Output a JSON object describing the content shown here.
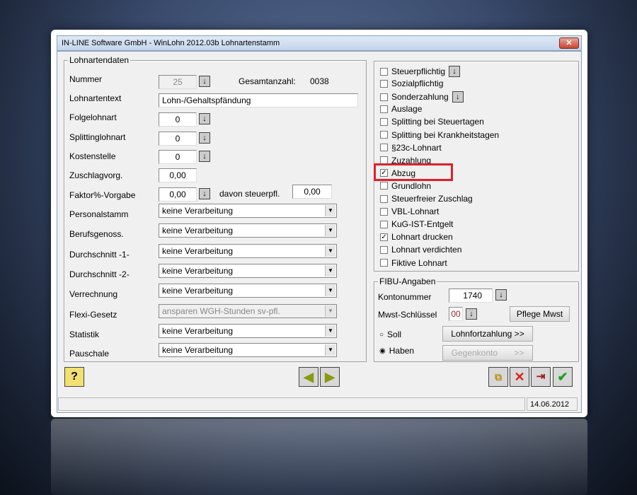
{
  "window": {
    "title": "IN-LINE Software GmbH - WinLohn 2012.03b  Lohnartenstamm",
    "close": "✕"
  },
  "left": {
    "group": "Lohnartendaten",
    "nummer": {
      "label": "Nummer",
      "value": "25"
    },
    "gesamt": {
      "label": "Gesamtanzahl:",
      "value": "0038"
    },
    "text": {
      "label": "Lohnartentext",
      "value": "Lohn-/Gehaltspfändung"
    },
    "folge": {
      "label": "Folgelohnart",
      "value": "0"
    },
    "splitting": {
      "label": "Splittinglohnart",
      "value": "0"
    },
    "kosten": {
      "label": "Kostenstelle",
      "value": "0"
    },
    "zuschlag": {
      "label": "Zuschlagvorg.",
      "value": "0,00"
    },
    "faktor": {
      "label": "Faktor%-Vorgabe",
      "value": "0,00"
    },
    "davon": {
      "label": "davon steuerpfl.",
      "value": "0,00"
    },
    "selects": [
      {
        "label": "Personalstamm",
        "value": "keine Verarbeitung"
      },
      {
        "label": "Berufsgenoss.",
        "value": "keine Verarbeitung"
      },
      {
        "label": "Durchschnitt -1-",
        "value": "keine Verarbeitung"
      },
      {
        "label": "Durchschnitt -2-",
        "value": "keine Verarbeitung"
      },
      {
        "label": "Verrechnung",
        "value": "keine Verarbeitung"
      },
      {
        "label": "Flexi-Gesetz",
        "value": "ansparen WGH-Stunden sv-pfl."
      },
      {
        "label": "Statistik",
        "value": "keine Verarbeitung"
      },
      {
        "label": "Pauschale",
        "value": "keine Verarbeitung"
      }
    ]
  },
  "checks": [
    {
      "label": "Steuerpflichtig",
      "checked": false
    },
    {
      "label": "Sozialpflichtig",
      "checked": false
    },
    {
      "label": "Sonderzahlung",
      "checked": false
    },
    {
      "label": "Auslage",
      "checked": false
    },
    {
      "label": "Splitting bei Steuertagen",
      "checked": false
    },
    {
      "label": "Splitting bei Krankheitstagen",
      "checked": false
    },
    {
      "label": "§23c-Lohnart",
      "checked": false
    },
    {
      "label": "Zuzahlung",
      "checked": false
    },
    {
      "label": "Abzug",
      "checked": true
    },
    {
      "label": "Grundlohn",
      "checked": false
    },
    {
      "label": "Steuerfreier Zuschlag",
      "checked": false
    },
    {
      "label": "VBL-Lohnart",
      "checked": false
    },
    {
      "label": "KuG-IST-Entgelt",
      "checked": false
    },
    {
      "label": "Lohnart drucken",
      "checked": true
    },
    {
      "label": "Lohnart verdichten",
      "checked": false
    },
    {
      "label": "Fiktive Lohnart",
      "checked": false
    }
  ],
  "fibu": {
    "group": "FIBU-Angaben",
    "konto_label": "Kontonummer",
    "konto": "1740",
    "mwst_label": "Mwst-Schlüssel",
    "mwst": "00",
    "pflege": "Pflege Mwst",
    "soll": "Soll",
    "haben": "Haben",
    "lohnfort": "Lohnfortzahlung >>",
    "gegenkonto": "Gegenkonto",
    "gegen_arrow": ">>",
    "selected": "Haben"
  },
  "status": {
    "date": "14.06.2012"
  },
  "colors": {
    "highlight": "#e0202a"
  }
}
